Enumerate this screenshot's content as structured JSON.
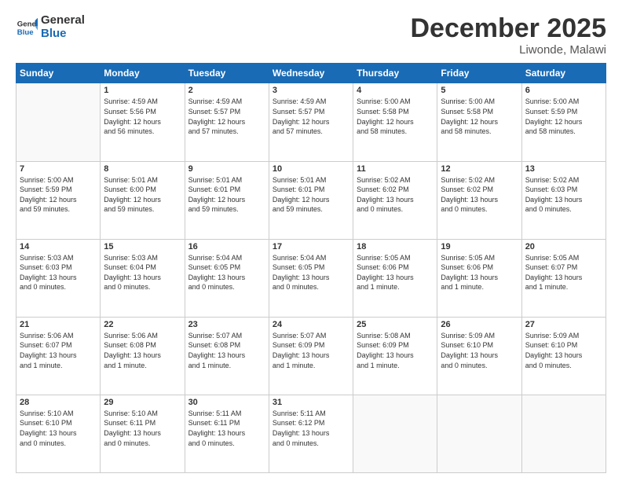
{
  "header": {
    "logo_general": "General",
    "logo_blue": "Blue",
    "month_year": "December 2025",
    "location": "Liwonde, Malawi"
  },
  "weekdays": [
    "Sunday",
    "Monday",
    "Tuesday",
    "Wednesday",
    "Thursday",
    "Friday",
    "Saturday"
  ],
  "weeks": [
    [
      {
        "day": "",
        "info": ""
      },
      {
        "day": "1",
        "info": "Sunrise: 4:59 AM\nSunset: 5:56 PM\nDaylight: 12 hours\nand 56 minutes."
      },
      {
        "day": "2",
        "info": "Sunrise: 4:59 AM\nSunset: 5:57 PM\nDaylight: 12 hours\nand 57 minutes."
      },
      {
        "day": "3",
        "info": "Sunrise: 4:59 AM\nSunset: 5:57 PM\nDaylight: 12 hours\nand 57 minutes."
      },
      {
        "day": "4",
        "info": "Sunrise: 5:00 AM\nSunset: 5:58 PM\nDaylight: 12 hours\nand 58 minutes."
      },
      {
        "day": "5",
        "info": "Sunrise: 5:00 AM\nSunset: 5:58 PM\nDaylight: 12 hours\nand 58 minutes."
      },
      {
        "day": "6",
        "info": "Sunrise: 5:00 AM\nSunset: 5:59 PM\nDaylight: 12 hours\nand 58 minutes."
      }
    ],
    [
      {
        "day": "7",
        "info": "Sunrise: 5:00 AM\nSunset: 5:59 PM\nDaylight: 12 hours\nand 59 minutes."
      },
      {
        "day": "8",
        "info": "Sunrise: 5:01 AM\nSunset: 6:00 PM\nDaylight: 12 hours\nand 59 minutes."
      },
      {
        "day": "9",
        "info": "Sunrise: 5:01 AM\nSunset: 6:01 PM\nDaylight: 12 hours\nand 59 minutes."
      },
      {
        "day": "10",
        "info": "Sunrise: 5:01 AM\nSunset: 6:01 PM\nDaylight: 12 hours\nand 59 minutes."
      },
      {
        "day": "11",
        "info": "Sunrise: 5:02 AM\nSunset: 6:02 PM\nDaylight: 13 hours\nand 0 minutes."
      },
      {
        "day": "12",
        "info": "Sunrise: 5:02 AM\nSunset: 6:02 PM\nDaylight: 13 hours\nand 0 minutes."
      },
      {
        "day": "13",
        "info": "Sunrise: 5:02 AM\nSunset: 6:03 PM\nDaylight: 13 hours\nand 0 minutes."
      }
    ],
    [
      {
        "day": "14",
        "info": "Sunrise: 5:03 AM\nSunset: 6:03 PM\nDaylight: 13 hours\nand 0 minutes."
      },
      {
        "day": "15",
        "info": "Sunrise: 5:03 AM\nSunset: 6:04 PM\nDaylight: 13 hours\nand 0 minutes."
      },
      {
        "day": "16",
        "info": "Sunrise: 5:04 AM\nSunset: 6:05 PM\nDaylight: 13 hours\nand 0 minutes."
      },
      {
        "day": "17",
        "info": "Sunrise: 5:04 AM\nSunset: 6:05 PM\nDaylight: 13 hours\nand 0 minutes."
      },
      {
        "day": "18",
        "info": "Sunrise: 5:05 AM\nSunset: 6:06 PM\nDaylight: 13 hours\nand 1 minute."
      },
      {
        "day": "19",
        "info": "Sunrise: 5:05 AM\nSunset: 6:06 PM\nDaylight: 13 hours\nand 1 minute."
      },
      {
        "day": "20",
        "info": "Sunrise: 5:05 AM\nSunset: 6:07 PM\nDaylight: 13 hours\nand 1 minute."
      }
    ],
    [
      {
        "day": "21",
        "info": "Sunrise: 5:06 AM\nSunset: 6:07 PM\nDaylight: 13 hours\nand 1 minute."
      },
      {
        "day": "22",
        "info": "Sunrise: 5:06 AM\nSunset: 6:08 PM\nDaylight: 13 hours\nand 1 minute."
      },
      {
        "day": "23",
        "info": "Sunrise: 5:07 AM\nSunset: 6:08 PM\nDaylight: 13 hours\nand 1 minute."
      },
      {
        "day": "24",
        "info": "Sunrise: 5:07 AM\nSunset: 6:09 PM\nDaylight: 13 hours\nand 1 minute."
      },
      {
        "day": "25",
        "info": "Sunrise: 5:08 AM\nSunset: 6:09 PM\nDaylight: 13 hours\nand 1 minute."
      },
      {
        "day": "26",
        "info": "Sunrise: 5:09 AM\nSunset: 6:10 PM\nDaylight: 13 hours\nand 0 minutes."
      },
      {
        "day": "27",
        "info": "Sunrise: 5:09 AM\nSunset: 6:10 PM\nDaylight: 13 hours\nand 0 minutes."
      }
    ],
    [
      {
        "day": "28",
        "info": "Sunrise: 5:10 AM\nSunset: 6:10 PM\nDaylight: 13 hours\nand 0 minutes."
      },
      {
        "day": "29",
        "info": "Sunrise: 5:10 AM\nSunset: 6:11 PM\nDaylight: 13 hours\nand 0 minutes."
      },
      {
        "day": "30",
        "info": "Sunrise: 5:11 AM\nSunset: 6:11 PM\nDaylight: 13 hours\nand 0 minutes."
      },
      {
        "day": "31",
        "info": "Sunrise: 5:11 AM\nSunset: 6:12 PM\nDaylight: 13 hours\nand 0 minutes."
      },
      {
        "day": "",
        "info": ""
      },
      {
        "day": "",
        "info": ""
      },
      {
        "day": "",
        "info": ""
      }
    ]
  ]
}
